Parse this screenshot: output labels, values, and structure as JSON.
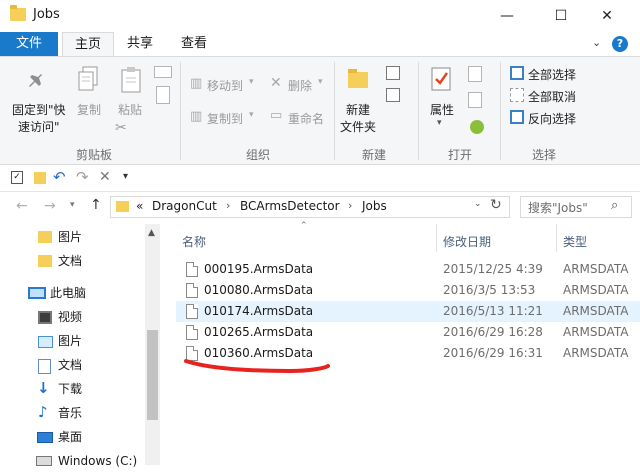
{
  "window": {
    "title": "Jobs",
    "minimize": "—",
    "maximize": "☐",
    "close": "✕"
  },
  "tabs": {
    "file": "文件",
    "home": "主页",
    "share": "共享",
    "view": "查看"
  },
  "ribbon": {
    "clipboard": {
      "pin_line1": "固定到\"快",
      "pin_line2": "速访问\"",
      "copy": "复制",
      "paste": "粘贴",
      "group": "剪贴板"
    },
    "organize": {
      "move_to": "移动到",
      "copy_to": "复制到",
      "delete": "删除",
      "rename": "重命名",
      "group": "组织"
    },
    "new": {
      "new_folder_line1": "新建",
      "new_folder_line2": "文件夹",
      "group": "新建"
    },
    "open": {
      "properties": "属性",
      "group": "打开"
    },
    "select": {
      "select_all": "全部选择",
      "select_none": "全部取消",
      "invert": "反向选择",
      "group": "选择"
    }
  },
  "address": {
    "prefix": "«",
    "crumbs": [
      "DragonCut",
      "BCArmsDetector",
      "Jobs"
    ],
    "search_placeholder": "搜索\"Jobs\""
  },
  "nav": {
    "items_top": [
      {
        "label": "图片"
      },
      {
        "label": "文档"
      }
    ],
    "this_pc": "此电脑",
    "items_pc": [
      {
        "label": "视频"
      },
      {
        "label": "图片"
      },
      {
        "label": "文档"
      },
      {
        "label": "下载"
      },
      {
        "label": "音乐"
      },
      {
        "label": "桌面"
      },
      {
        "label": "Windows (C:)"
      }
    ]
  },
  "columns": {
    "name": "名称",
    "date": "修改日期",
    "type": "类型"
  },
  "files": [
    {
      "name": "000195.ArmsData",
      "date": "2015/12/25 4:39",
      "type": "ARMSDATA"
    },
    {
      "name": "010080.ArmsData",
      "date": "2016/3/5 13:53",
      "type": "ARMSDATA"
    },
    {
      "name": "010174.ArmsData",
      "date": "2016/5/13 11:21",
      "type": "ARMSDATA"
    },
    {
      "name": "010265.ArmsData",
      "date": "2016/6/29 16:28",
      "type": "ARMSDATA"
    },
    {
      "name": "010360.ArmsData",
      "date": "2016/6/29 16:31",
      "type": "ARMSDATA"
    }
  ],
  "colors": {
    "accent": "#1979ca",
    "selection": "#e5f3ff",
    "annotation": "#e8221e"
  }
}
